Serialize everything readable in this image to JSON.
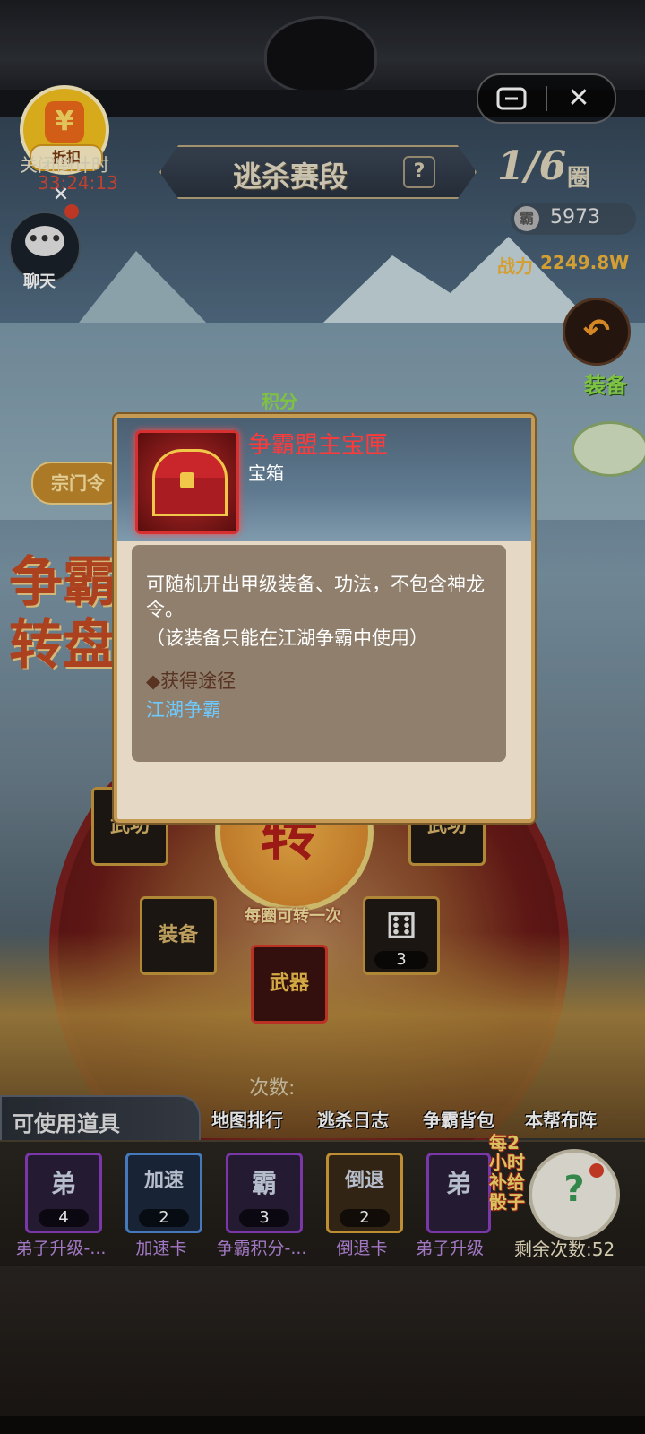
{
  "header": {
    "discount_label": "折扣",
    "countdown_label": "关闭倒计时",
    "countdown_value": "33:24:13",
    "stage_title": "逃杀赛段",
    "stage_help": "?",
    "round_value": "1/6",
    "round_unit": "圈",
    "score_icon": "霸",
    "score_value": "5973",
    "power_label": "战力",
    "power_value": "2249.8W",
    "chat_label": "聊天",
    "equip_label": "装备",
    "points_tag": "积分",
    "sect_chip": "宗门令"
  },
  "wheel": {
    "title": "争霸转盘",
    "center_char": "转",
    "tip": "每圈可转一次",
    "slots": [
      {
        "glyph": "武功",
        "count": ""
      },
      {
        "glyph": "武功",
        "count": ""
      },
      {
        "glyph": "装备",
        "count": ""
      },
      {
        "glyph": "⚅",
        "count": "3"
      },
      {
        "glyph": "武器",
        "count": ""
      }
    ]
  },
  "nav": {
    "count_label": "次数:",
    "map_rank": "地图排行",
    "kill_log": "逃杀日志",
    "bag": "争霸背包",
    "formation": "本帮布阵"
  },
  "items": {
    "title": "可使用道具",
    "list": [
      {
        "glyph": "弟",
        "count": "4",
        "name": "弟子升级-..."
      },
      {
        "glyph": "加速",
        "count": "2",
        "name": "加速卡"
      },
      {
        "glyph": "霸",
        "count": "3",
        "name": "争霸积分-..."
      },
      {
        "glyph": "倒退",
        "count": "2",
        "name": "倒退卡"
      },
      {
        "glyph": "弟",
        "count": "",
        "name": "弟子升级"
      }
    ],
    "reminder": "每2小时补给骰子",
    "dice_glyph": "?",
    "remaining": "剩余次数:52"
  },
  "popup": {
    "name": "争霸盟主宝匣",
    "type": "宝箱",
    "description_1": "可随机开出甲级装备、功法，不包含神龙令。",
    "description_2": "（该装备只能在江湖争霸中使用）",
    "source_heading": "◆获得途径",
    "source_link": "江湖争霸"
  },
  "colors": {
    "item_name_red": "#ff3a3a",
    "link_blue": "#6ec9ff",
    "power_gold": "#f1b63a",
    "green_label": "#8fdd4c"
  }
}
